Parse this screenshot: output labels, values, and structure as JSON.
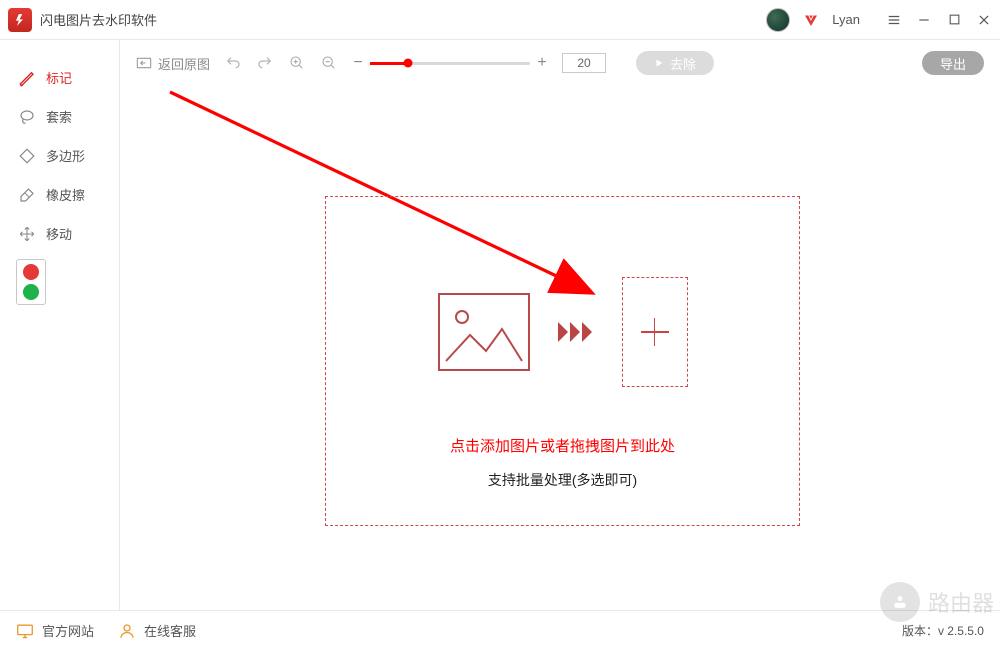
{
  "title": "闪电图片去水印软件",
  "user": {
    "name": "Lyan"
  },
  "sidebar": {
    "tools": [
      {
        "label": "标记",
        "active": true
      },
      {
        "label": "套索",
        "active": false
      },
      {
        "label": "多边形",
        "active": false
      },
      {
        "label": "橡皮擦",
        "active": false
      },
      {
        "label": "移动",
        "active": false
      }
    ]
  },
  "toolbar": {
    "back_label": "返回原图",
    "zoom_value": "20",
    "remove_label": "去除",
    "export_label": "导出"
  },
  "drop": {
    "line1": "点击添加图片或者拖拽图片到此处",
    "line2": "支持批量处理(多选即可)"
  },
  "footer": {
    "site_label": "官方网站",
    "support_label": "在线客服",
    "version_label": "版本：v 2.5.5.0"
  },
  "watermark": {
    "text": "路由器"
  }
}
